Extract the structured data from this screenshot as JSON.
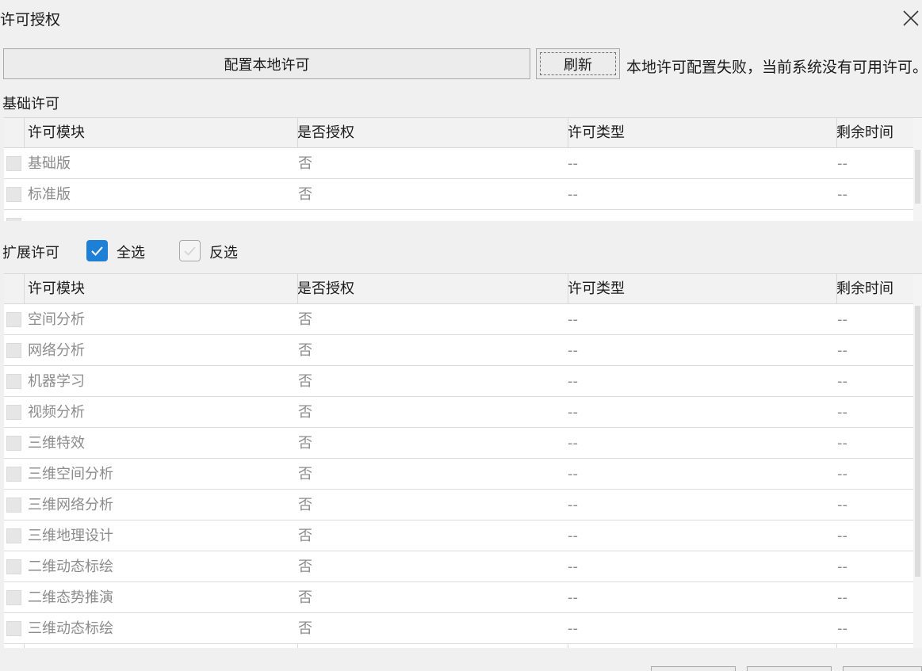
{
  "dialog": {
    "title": "许可授权"
  },
  "toolbar": {
    "config_label": "配置本地许可",
    "refresh_label": "刷新",
    "status_text": "本地许可配置失败，当前系统没有可用许可。"
  },
  "basic": {
    "label": "基础许可",
    "headers": [
      "许可模块",
      "是否授权",
      "许可类型",
      "剩余时间"
    ],
    "rows": [
      {
        "name": "基础版",
        "auth": "否",
        "type": "--",
        "time": "--"
      },
      {
        "name": "标准版",
        "auth": "否",
        "type": "--",
        "time": "--"
      },
      {
        "name": "",
        "auth": "",
        "type": "",
        "time": ""
      }
    ]
  },
  "extension": {
    "label": "扩展许可",
    "select_all": "全选",
    "select_all_checked": true,
    "invert": "反选",
    "invert_checked": false,
    "headers": [
      "许可模块",
      "是否授权",
      "许可类型",
      "剩余时间"
    ],
    "rows": [
      {
        "name": "空间分析",
        "auth": "否",
        "type": "--",
        "time": "--"
      },
      {
        "name": "网络分析",
        "auth": "否",
        "type": "--",
        "time": "--"
      },
      {
        "name": "机器学习",
        "auth": "否",
        "type": "--",
        "time": "--"
      },
      {
        "name": "视频分析",
        "auth": "否",
        "type": "--",
        "time": "--"
      },
      {
        "name": "三维特效",
        "auth": "否",
        "type": "--",
        "time": "--"
      },
      {
        "name": "三维空间分析",
        "auth": "否",
        "type": "--",
        "time": "--"
      },
      {
        "name": "三维网络分析",
        "auth": "否",
        "type": "--",
        "time": "--"
      },
      {
        "name": "三维地理设计",
        "auth": "否",
        "type": "--",
        "time": "--"
      },
      {
        "name": "二维动态标绘",
        "auth": "否",
        "type": "--",
        "time": "--"
      },
      {
        "name": "二维态势推演",
        "auth": "否",
        "type": "--",
        "time": "--"
      },
      {
        "name": "三维动态标绘",
        "auth": "否",
        "type": "--",
        "time": "--"
      }
    ]
  },
  "colors": {
    "accent": "#1e7fd6",
    "disabled_text": "#8c8c8c"
  }
}
